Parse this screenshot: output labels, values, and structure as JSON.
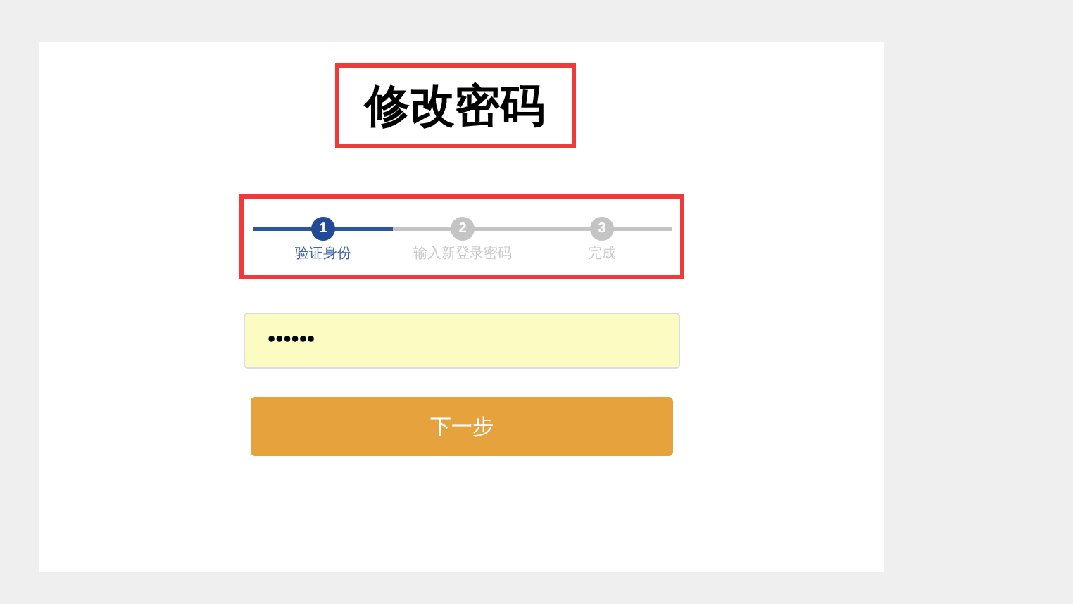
{
  "title": "修改密码",
  "steps": [
    {
      "number": "1",
      "label": "验证身份",
      "selected": true
    },
    {
      "number": "2",
      "label": "输入新登录密码",
      "selected": false
    },
    {
      "number": "3",
      "label": "完成",
      "selected": false
    }
  ],
  "password_field": {
    "value": "••••••"
  },
  "next_button": {
    "label": "下一步"
  }
}
